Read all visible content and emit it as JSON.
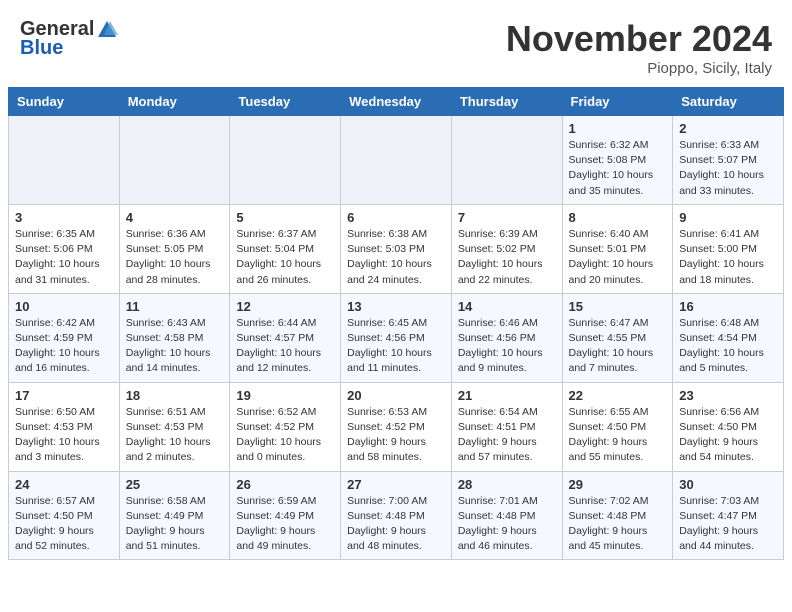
{
  "header": {
    "logo_general": "General",
    "logo_blue": "Blue",
    "title": "November 2024",
    "location": "Pioppo, Sicily, Italy"
  },
  "days_of_week": [
    "Sunday",
    "Monday",
    "Tuesday",
    "Wednesday",
    "Thursday",
    "Friday",
    "Saturday"
  ],
  "weeks": [
    [
      {
        "day": "",
        "info": ""
      },
      {
        "day": "",
        "info": ""
      },
      {
        "day": "",
        "info": ""
      },
      {
        "day": "",
        "info": ""
      },
      {
        "day": "",
        "info": ""
      },
      {
        "day": "1",
        "info": "Sunrise: 6:32 AM\nSunset: 5:08 PM\nDaylight: 10 hours and 35 minutes."
      },
      {
        "day": "2",
        "info": "Sunrise: 6:33 AM\nSunset: 5:07 PM\nDaylight: 10 hours and 33 minutes."
      }
    ],
    [
      {
        "day": "3",
        "info": "Sunrise: 6:35 AM\nSunset: 5:06 PM\nDaylight: 10 hours and 31 minutes."
      },
      {
        "day": "4",
        "info": "Sunrise: 6:36 AM\nSunset: 5:05 PM\nDaylight: 10 hours and 28 minutes."
      },
      {
        "day": "5",
        "info": "Sunrise: 6:37 AM\nSunset: 5:04 PM\nDaylight: 10 hours and 26 minutes."
      },
      {
        "day": "6",
        "info": "Sunrise: 6:38 AM\nSunset: 5:03 PM\nDaylight: 10 hours and 24 minutes."
      },
      {
        "day": "7",
        "info": "Sunrise: 6:39 AM\nSunset: 5:02 PM\nDaylight: 10 hours and 22 minutes."
      },
      {
        "day": "8",
        "info": "Sunrise: 6:40 AM\nSunset: 5:01 PM\nDaylight: 10 hours and 20 minutes."
      },
      {
        "day": "9",
        "info": "Sunrise: 6:41 AM\nSunset: 5:00 PM\nDaylight: 10 hours and 18 minutes."
      }
    ],
    [
      {
        "day": "10",
        "info": "Sunrise: 6:42 AM\nSunset: 4:59 PM\nDaylight: 10 hours and 16 minutes."
      },
      {
        "day": "11",
        "info": "Sunrise: 6:43 AM\nSunset: 4:58 PM\nDaylight: 10 hours and 14 minutes."
      },
      {
        "day": "12",
        "info": "Sunrise: 6:44 AM\nSunset: 4:57 PM\nDaylight: 10 hours and 12 minutes."
      },
      {
        "day": "13",
        "info": "Sunrise: 6:45 AM\nSunset: 4:56 PM\nDaylight: 10 hours and 11 minutes."
      },
      {
        "day": "14",
        "info": "Sunrise: 6:46 AM\nSunset: 4:56 PM\nDaylight: 10 hours and 9 minutes."
      },
      {
        "day": "15",
        "info": "Sunrise: 6:47 AM\nSunset: 4:55 PM\nDaylight: 10 hours and 7 minutes."
      },
      {
        "day": "16",
        "info": "Sunrise: 6:48 AM\nSunset: 4:54 PM\nDaylight: 10 hours and 5 minutes."
      }
    ],
    [
      {
        "day": "17",
        "info": "Sunrise: 6:50 AM\nSunset: 4:53 PM\nDaylight: 10 hours and 3 minutes."
      },
      {
        "day": "18",
        "info": "Sunrise: 6:51 AM\nSunset: 4:53 PM\nDaylight: 10 hours and 2 minutes."
      },
      {
        "day": "19",
        "info": "Sunrise: 6:52 AM\nSunset: 4:52 PM\nDaylight: 10 hours and 0 minutes."
      },
      {
        "day": "20",
        "info": "Sunrise: 6:53 AM\nSunset: 4:52 PM\nDaylight: 9 hours and 58 minutes."
      },
      {
        "day": "21",
        "info": "Sunrise: 6:54 AM\nSunset: 4:51 PM\nDaylight: 9 hours and 57 minutes."
      },
      {
        "day": "22",
        "info": "Sunrise: 6:55 AM\nSunset: 4:50 PM\nDaylight: 9 hours and 55 minutes."
      },
      {
        "day": "23",
        "info": "Sunrise: 6:56 AM\nSunset: 4:50 PM\nDaylight: 9 hours and 54 minutes."
      }
    ],
    [
      {
        "day": "24",
        "info": "Sunrise: 6:57 AM\nSunset: 4:50 PM\nDaylight: 9 hours and 52 minutes."
      },
      {
        "day": "25",
        "info": "Sunrise: 6:58 AM\nSunset: 4:49 PM\nDaylight: 9 hours and 51 minutes."
      },
      {
        "day": "26",
        "info": "Sunrise: 6:59 AM\nSunset: 4:49 PM\nDaylight: 9 hours and 49 minutes."
      },
      {
        "day": "27",
        "info": "Sunrise: 7:00 AM\nSunset: 4:48 PM\nDaylight: 9 hours and 48 minutes."
      },
      {
        "day": "28",
        "info": "Sunrise: 7:01 AM\nSunset: 4:48 PM\nDaylight: 9 hours and 46 minutes."
      },
      {
        "day": "29",
        "info": "Sunrise: 7:02 AM\nSunset: 4:48 PM\nDaylight: 9 hours and 45 minutes."
      },
      {
        "day": "30",
        "info": "Sunrise: 7:03 AM\nSunset: 4:47 PM\nDaylight: 9 hours and 44 minutes."
      }
    ]
  ]
}
